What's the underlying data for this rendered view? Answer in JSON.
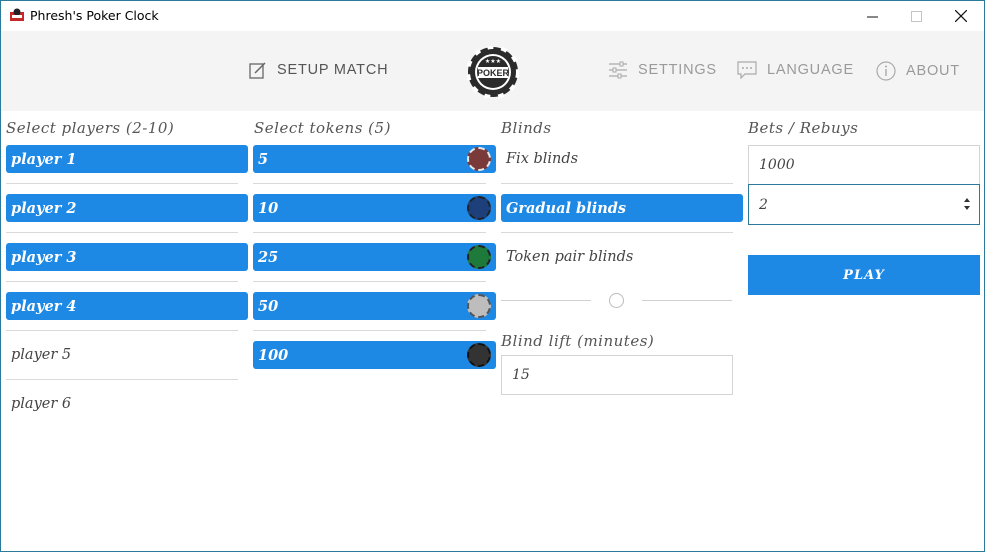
{
  "window": {
    "title": "Phresh's Poker Clock",
    "minimize": "—",
    "maximize": "☐",
    "close": "✕"
  },
  "nav": {
    "setup_match": "SETUP MATCH",
    "settings": "SETTINGS",
    "language": "LANGUAGE",
    "about": "ABOUT",
    "logo_text": "POKER"
  },
  "players": {
    "label": "Select players (2-10)",
    "items": [
      {
        "name": "player 1",
        "selected": true
      },
      {
        "name": "player 2",
        "selected": true
      },
      {
        "name": "player 3",
        "selected": true
      },
      {
        "name": "player 4",
        "selected": true
      },
      {
        "name": "player 5",
        "selected": false
      },
      {
        "name": "player 6",
        "selected": false
      }
    ]
  },
  "tokens": {
    "label": "Select tokens (5)",
    "items": [
      {
        "value": "5",
        "color": "#7a3a3a",
        "selected": true
      },
      {
        "value": "10",
        "color": "#1d3f7a",
        "selected": true
      },
      {
        "value": "25",
        "color": "#1e7a3a",
        "selected": true
      },
      {
        "value": "50",
        "color": "#bdbdbd",
        "selected": true
      },
      {
        "value": "100",
        "color": "#333333",
        "selected": true
      }
    ]
  },
  "blinds": {
    "label": "Blinds",
    "options": [
      {
        "label": "Fix blinds",
        "selected": false
      },
      {
        "label": "Gradual blinds",
        "selected": true
      },
      {
        "label": "Token pair blinds",
        "selected": false
      }
    ],
    "lift_label": "Blind lift (minutes)",
    "lift_value": "15"
  },
  "bets": {
    "label": "Bets / Rebuys",
    "bet_value": "1000",
    "rebuys_value": "2",
    "play_label": "PLAY"
  },
  "colors": {
    "accent": "#1e88e5",
    "nav_bg": "#f4f4f4"
  }
}
